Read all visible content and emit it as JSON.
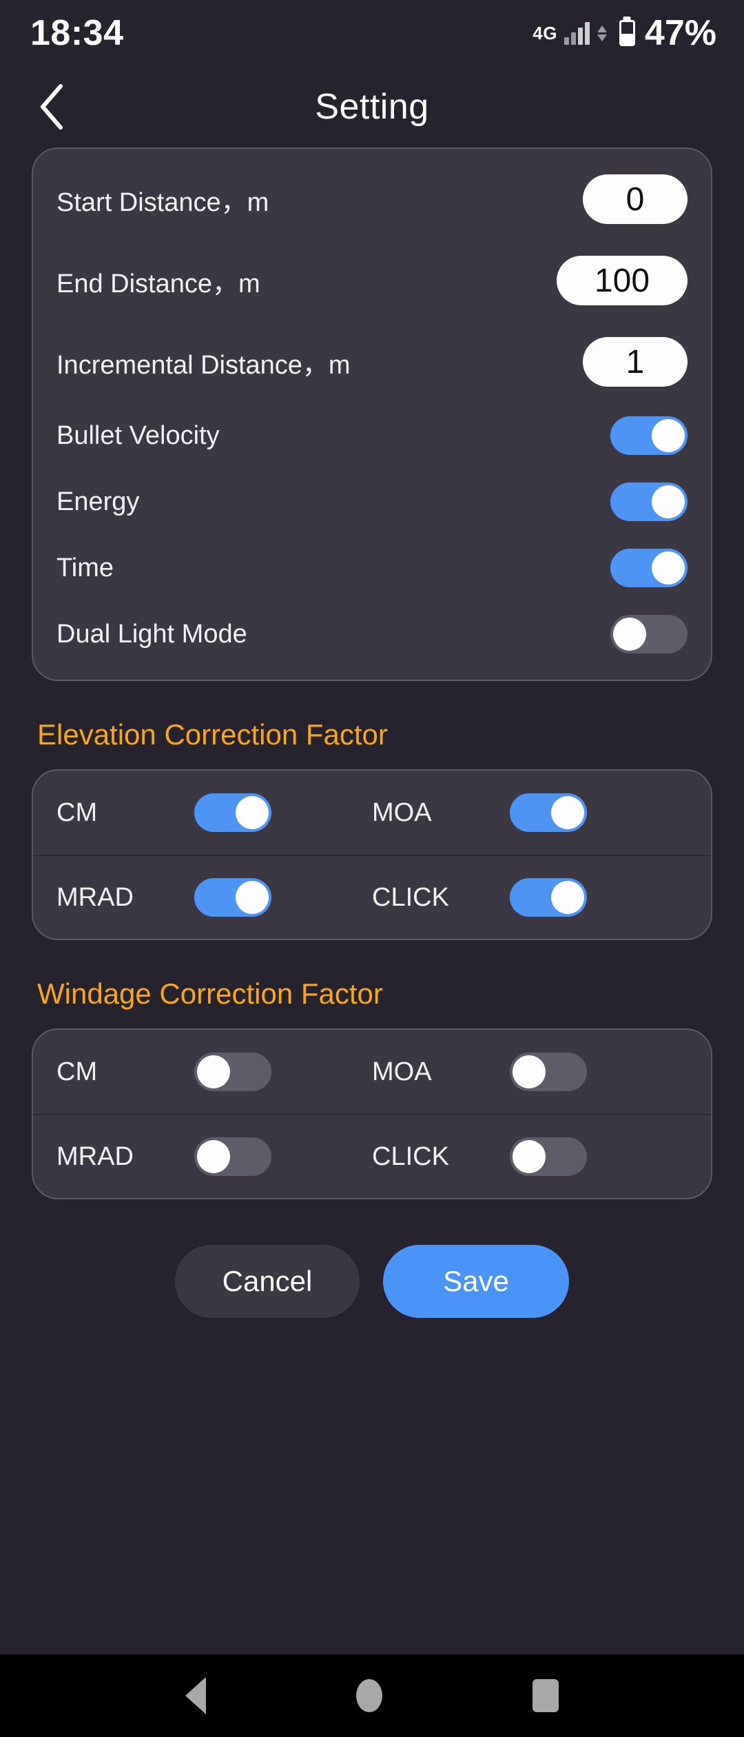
{
  "status_bar": {
    "time": "18:34",
    "network_type": "4G",
    "battery_percent": "47%",
    "signal_icon": "signal-bars-icon",
    "data_arrows_icon": "data-transfer-icon",
    "battery_icon": "battery-icon"
  },
  "header": {
    "back_icon": "chevron-left-icon",
    "title": "Setting"
  },
  "main_settings": {
    "rows": [
      {
        "label": "Start Distance，m",
        "type": "input",
        "value": "0"
      },
      {
        "label": "End Distance，m",
        "type": "input",
        "value": "100"
      },
      {
        "label": "Incremental Distance，m",
        "type": "input",
        "value": "1"
      },
      {
        "label": "Bullet Velocity",
        "type": "toggle",
        "state": "on"
      },
      {
        "label": "Energy",
        "type": "toggle",
        "state": "on"
      },
      {
        "label": "Time",
        "type": "toggle",
        "state": "on"
      },
      {
        "label": "Dual Light Mode",
        "type": "toggle",
        "state": "off"
      }
    ]
  },
  "elevation": {
    "title": "Elevation Correction Factor",
    "rows": [
      [
        {
          "label": "CM",
          "state": "on"
        },
        {
          "label": "MOA",
          "state": "on"
        }
      ],
      [
        {
          "label": "MRAD",
          "state": "on"
        },
        {
          "label": "CLICK",
          "state": "on"
        }
      ]
    ]
  },
  "windage": {
    "title": "Windage Correction Factor",
    "rows": [
      [
        {
          "label": "CM",
          "state": "off"
        },
        {
          "label": "MOA",
          "state": "off"
        }
      ],
      [
        {
          "label": "MRAD",
          "state": "off"
        },
        {
          "label": "CLICK",
          "state": "off"
        }
      ]
    ]
  },
  "actions": {
    "cancel_label": "Cancel",
    "save_label": "Save"
  },
  "nav_bar": {
    "back_icon": "triangle-back-icon",
    "home_icon": "circle-home-icon",
    "recents_icon": "square-recents-icon"
  },
  "colors": {
    "page_background": "#26232e",
    "card_background": "#3b3844",
    "accent_orange": "#faa61a",
    "toggle_on": "#4d94f5",
    "toggle_off": "#5d5c68",
    "save_blue": "#4a94f7"
  }
}
